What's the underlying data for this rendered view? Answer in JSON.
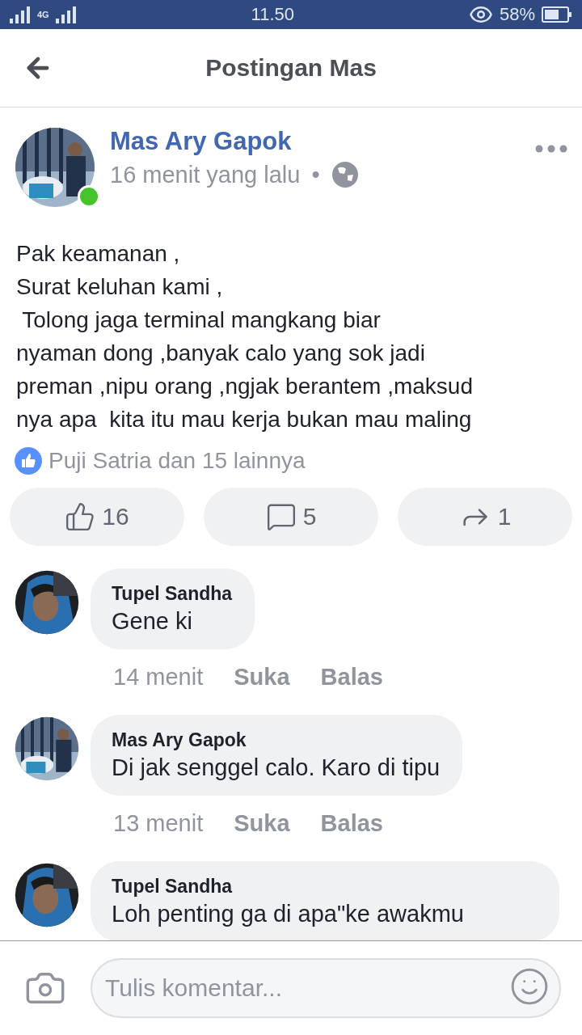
{
  "status_bar": {
    "network": "4G",
    "time": "11.50",
    "battery": "58%"
  },
  "header": {
    "title": "Postingan Mas"
  },
  "post": {
    "author": "Mas Ary Gapok",
    "online": true,
    "time": "16 menit yang lalu",
    "separator": "•",
    "lines": [
      "Pak keamanan ,",
      "Surat keluhan kami ,",
      " Tolong jaga terminal mangkang biar",
      "nyaman dong ,banyak calo yang sok jadi",
      "preman ,nipu orang ,ngjak berantem ,maksud",
      "nya apa  kita itu mau kerja bukan mau maling"
    ],
    "reactions": "Puji Satria dan 15 lainnya",
    "actions": [
      {
        "kind": "like",
        "count": "16"
      },
      {
        "kind": "comment",
        "count": "5"
      },
      {
        "kind": "share",
        "count": "1"
      }
    ]
  },
  "comments": [
    {
      "author": "Tupel Sandha",
      "text": "Gene ki",
      "time": "14 menit",
      "like": "Suka",
      "reply": "Balas"
    },
    {
      "author": "Mas Ary Gapok",
      "text": "Di jak senggel calo. Karo di tipu",
      "time": "13 menit",
      "like": "Suka",
      "reply": "Balas"
    },
    {
      "author": "Tupel Sandha",
      "text": "Loh penting ga di apa\"ke awakmu"
    }
  ],
  "composer": {
    "placeholder": "Tulis komentar..."
  }
}
